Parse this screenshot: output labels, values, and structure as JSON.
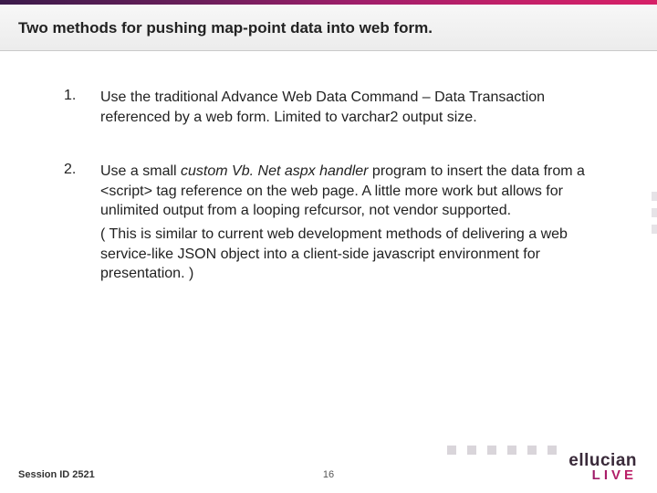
{
  "title": "Two methods for pushing map-point data into web form.",
  "items": [
    {
      "num": "1.",
      "paras": [
        "Use the traditional Advance Web Data Command – Data Transaction referenced by a web form. Limited to varchar2 output size."
      ]
    },
    {
      "num": "2.",
      "paras": [
        "Use a small <em>custom Vb. Net aspx handler</em> program to insert the data from a <script> tag reference on the web page. A little more work but allows for unlimited output from a looping refcursor, not vendor supported.",
        "( This is similar to current web development methods of delivering a web service-like JSON object into a client-side javascript environment for presentation. )"
      ]
    }
  ],
  "footer": {
    "session": "Session ID 2521",
    "page": "16",
    "logo_brand": "ellucian",
    "logo_live": "LIVE"
  }
}
